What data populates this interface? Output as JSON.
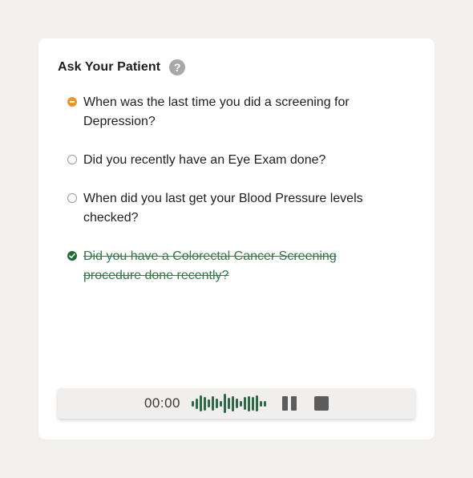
{
  "panel": {
    "title": "Ask Your Patient",
    "help_icon": "?"
  },
  "questions": [
    {
      "text": "When was the last time you did a screening for Depression?",
      "status": "partial",
      "icon": "dash-circle-icon",
      "color": "#e8962e"
    },
    {
      "text": "Did you recently have an Eye Exam done?",
      "status": "pending",
      "icon": "empty-circle-icon"
    },
    {
      "text": "When did you last get your Blood Pressure levels checked?",
      "status": "pending",
      "icon": "empty-circle-icon"
    },
    {
      "text": "Did you have a Colorectal Cancer Screening procedure done recently?",
      "status": "completed",
      "icon": "check-circle-icon",
      "color": "#2e7a45"
    }
  ],
  "recorder": {
    "time": "00:00",
    "waveform_color": "#2d6a45",
    "waveform_levels": [
      0.3,
      0.55,
      0.85,
      0.7,
      0.4,
      0.75,
      0.5,
      0.3,
      1.0,
      0.6,
      0.8,
      0.5,
      0.3,
      0.65,
      0.8,
      0.7,
      0.85,
      0.3,
      0.3
    ],
    "pause_icon": "pause-icon",
    "stop_icon": "stop-icon"
  }
}
